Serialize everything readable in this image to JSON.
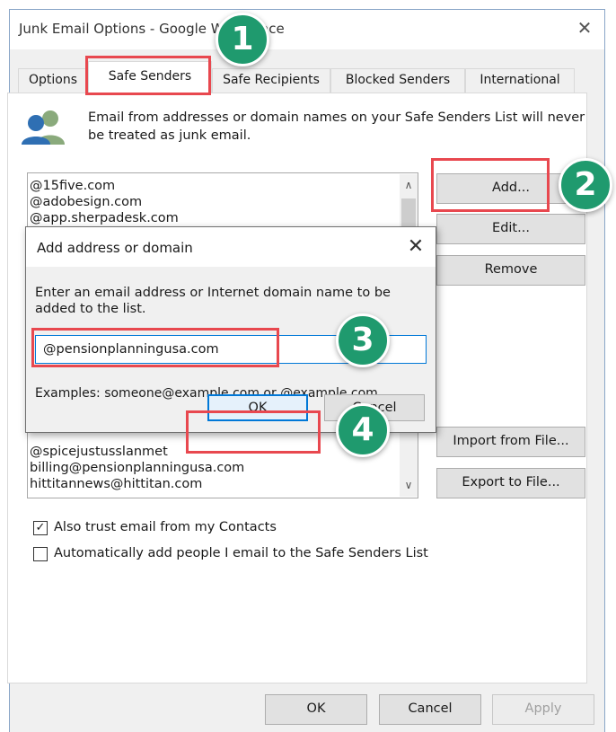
{
  "window": {
    "title": "Junk Email Options - Google Workspace",
    "close_icon": "✕"
  },
  "tabs": [
    {
      "label": "Options"
    },
    {
      "label": "Safe Senders"
    },
    {
      "label": "Safe Recipients"
    },
    {
      "label": "Blocked Senders"
    },
    {
      "label": "International"
    }
  ],
  "description": "Email from addresses or domain names on your Safe Senders List will never be treated as junk email.",
  "safe_senders_list": {
    "items": [
      "@15five.com",
      "@adobesign.com",
      "@app.sherpadesk.com",
      "@spicejustusslanmet",
      "billing@pensionplanningusa.com",
      "hittitannews@hittitan.com"
    ]
  },
  "buttons": {
    "add": "Add...",
    "edit": "Edit...",
    "remove": "Remove",
    "import": "Import from File...",
    "export": "Export to File..."
  },
  "checkboxes": {
    "trust_contacts": {
      "label": "Also trust email from my Contacts",
      "checked": true
    },
    "auto_add": {
      "label": "Automatically add people I email to the Safe Senders List",
      "checked": false
    }
  },
  "dialog": {
    "title": "Add address or domain",
    "instruction": "Enter an email address or Internet domain name to be added to the list.",
    "input_value": "@pensionplanningusa.com",
    "examples": "Examples: someone@example.com or @example.com",
    "ok_label": "OK",
    "cancel_label": "Cancel",
    "close_icon": "✕"
  },
  "footer": {
    "ok": "OK",
    "cancel": "Cancel",
    "apply": "Apply"
  },
  "callouts": [
    {
      "number": "1"
    },
    {
      "number": "2"
    },
    {
      "number": "3"
    },
    {
      "number": "4"
    }
  ],
  "colors": {
    "highlight": "#e8484f",
    "badge": "#1f9a6e",
    "accent": "#0078d7"
  },
  "icons": {
    "people": "people-icon",
    "check": "✓",
    "scroll_up": "∧",
    "scroll_down": "∨"
  }
}
